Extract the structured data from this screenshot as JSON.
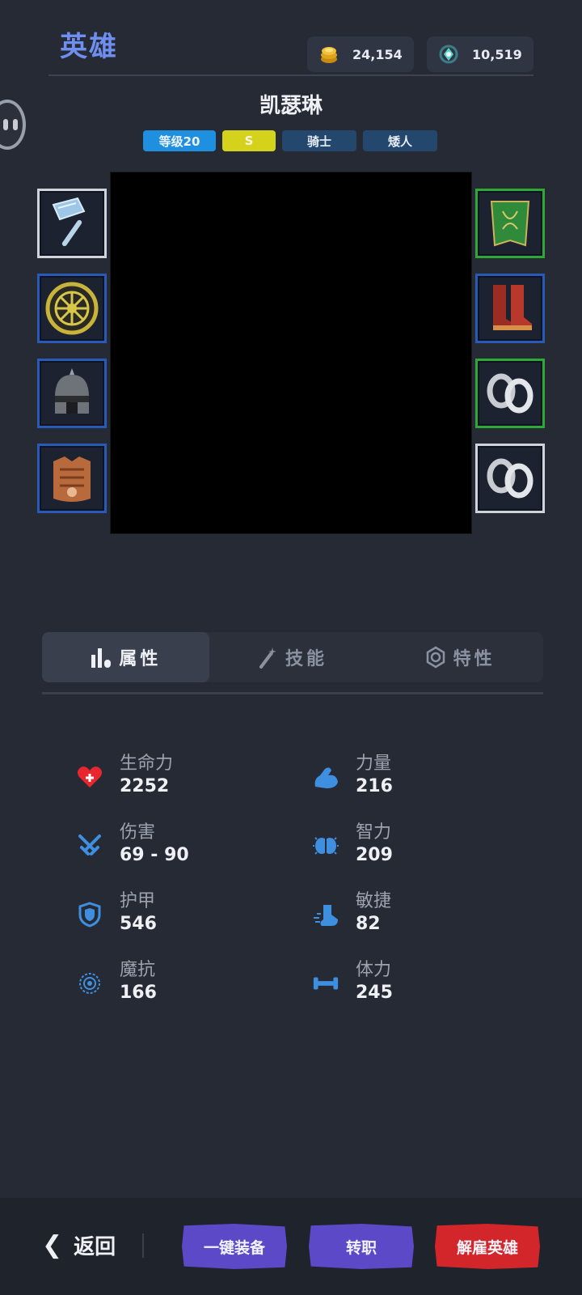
{
  "header": {
    "title": "英雄",
    "gold": "24,154",
    "gems": "10,519"
  },
  "hero": {
    "name": "凯瑟琳",
    "tags": {
      "level": "等级20",
      "rank": "S",
      "class": "骑士",
      "race": "矮人"
    }
  },
  "equipment": {
    "left": [
      "warhammer-icon",
      "round-shield-icon",
      "helmet-icon",
      "chest-armor-icon"
    ],
    "right": [
      "cloak-icon",
      "boots-icon",
      "ring-icon",
      "ring-icon"
    ]
  },
  "tabs": [
    {
      "label": "属性",
      "icon": "bar-chart-icon",
      "active": true
    },
    {
      "label": "技能",
      "icon": "magic-wand-icon",
      "active": false
    },
    {
      "label": "特性",
      "icon": "trait-icon",
      "active": false
    }
  ],
  "stats": {
    "hp": {
      "label": "生命力",
      "value": "2252"
    },
    "damage": {
      "label": "伤害",
      "value": "69 - 90"
    },
    "armor": {
      "label": "护甲",
      "value": "546"
    },
    "magic_resist": {
      "label": "魔抗",
      "value": "166"
    },
    "strength": {
      "label": "力量",
      "value": "216"
    },
    "intellect": {
      "label": "智力",
      "value": "209"
    },
    "agility": {
      "label": "敏捷",
      "value": "82"
    },
    "stamina": {
      "label": "体力",
      "value": "245"
    }
  },
  "bottom": {
    "back": "返回",
    "equip_all": "一键装备",
    "change_job": "转职",
    "dismiss": "解雇英雄"
  },
  "colors": {
    "accent": "#6f8ff0",
    "background": "#262a35",
    "stat_icon": "#3f8fe0",
    "danger": "#d3262a",
    "primary_button": "#5b49c8"
  }
}
